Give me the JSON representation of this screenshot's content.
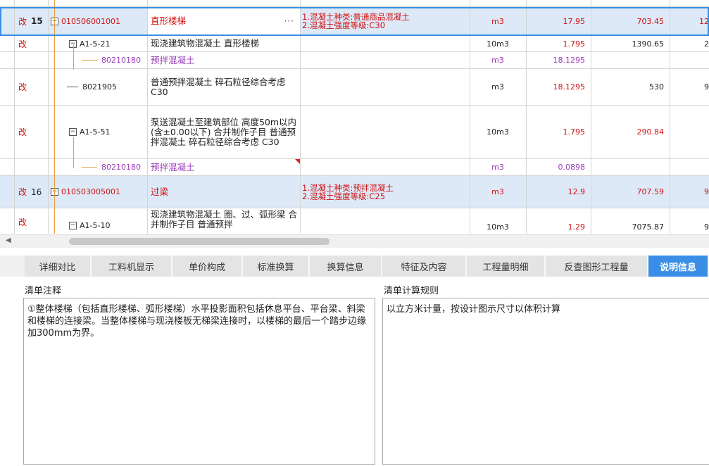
{
  "rows": [
    {
      "flag": "改",
      "num": "15",
      "code": "010506001001",
      "name": "直形楼梯",
      "features": [
        "1.混凝土种类:普通商品混凝土",
        "2.混凝土强度等级:C30"
      ],
      "unit": "m3",
      "qty": "17.95",
      "price": "703.45",
      "last": "12"
    },
    {
      "flag": "改",
      "code": "A1-5-21",
      "name": "现浇建筑物混凝土 直形楼梯",
      "unit": "10m3",
      "qty": "1.795",
      "price": "1390.65",
      "last": "2"
    },
    {
      "code": "80210180",
      "name": "预拌混凝土",
      "unit": "m3",
      "qty": "18.1295"
    },
    {
      "flag": "改",
      "code": "8021905",
      "name": "普通预拌混凝土 碎石粒径综合考虑 C30",
      "unit": "m3",
      "qty": "18.1295",
      "price": "530",
      "last": "9"
    },
    {
      "flag": "改",
      "code": "A1-5-51",
      "name": "泵送混凝土至建筑部位 高度50m以内(含±0.00以下)  合并制作子目 普通预拌混凝土 碎石粒径综合考虑 C30",
      "unit": "10m3",
      "qty": "1.795",
      "price": "290.84"
    },
    {
      "code": "80210180",
      "name": "预拌混凝土",
      "unit": "m3",
      "qty": "0.0898"
    },
    {
      "flag": "改",
      "num": "16",
      "code": "010503005001",
      "name": "过梁",
      "features": [
        "1.混凝土种类:预拌混凝土",
        "2.混凝土强度等级:C25"
      ],
      "unit": "m3",
      "qty": "12.9",
      "price": "707.59",
      "last": "9"
    },
    {
      "flag": "改",
      "code": "A1-5-10",
      "name": "现浇建筑物混凝土 圈、过、弧形梁  合并制作子目 普通预拌",
      "unit": "10m3",
      "qty": "1.29",
      "price": "7075.87",
      "last": "9"
    }
  ],
  "tree_icons": {
    "collapse": "−",
    "more_button": "···"
  },
  "scrollbar": {
    "left_arrow": "◀"
  },
  "tabs": [
    "详细对比",
    "工料机显示",
    "单价构成",
    "标准换算",
    "换算信息",
    "特征及内容",
    "工程量明细",
    "反查图形工程量",
    "说明信息"
  ],
  "left_panel": {
    "title": "清单注释",
    "text": "①整体楼梯（包括直形楼梯、弧形楼梯）水平投影面积包括休息平台、平台梁、斜梁和楼梯的连接梁。当整体楼梯与现浇楼板无梯梁连接时，以楼梯的最后一个踏步边缘加300mm为界。"
  },
  "right_panel": {
    "title": "清单计算规则",
    "text": "以立方米计量，按设计图示尺寸以体积计算"
  },
  "colors": {
    "accent": "#3a8ee6",
    "modified_red": "#d01010",
    "material_purple": "#9a3ab8",
    "tree_line": "#e0a040"
  }
}
